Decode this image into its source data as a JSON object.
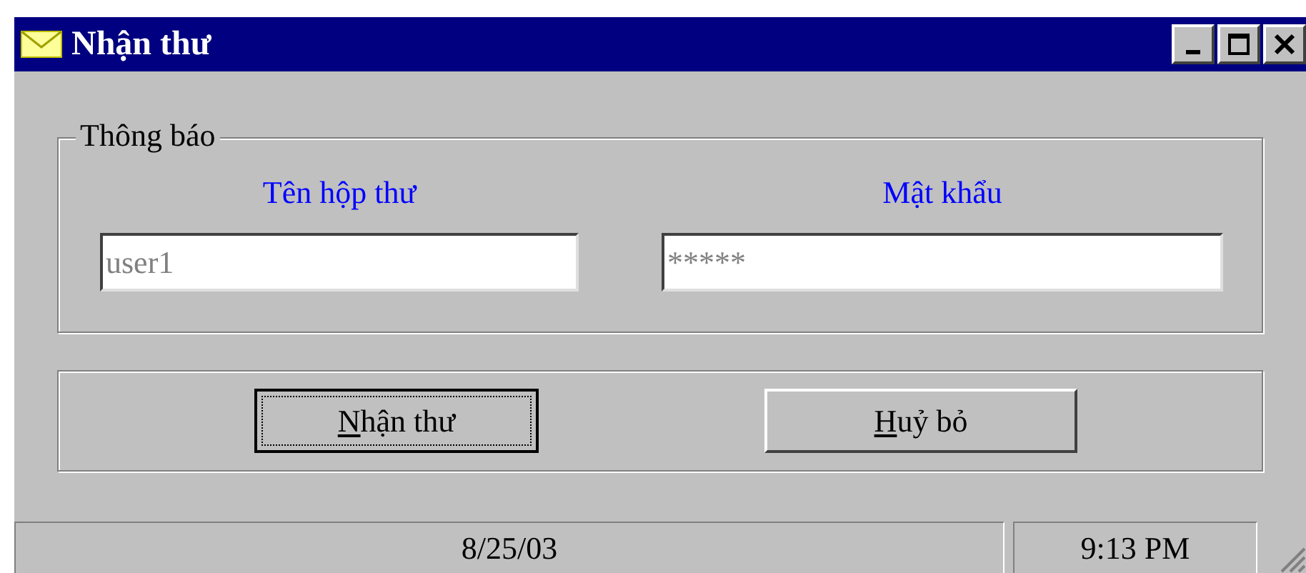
{
  "window": {
    "title": "Nhận thư"
  },
  "group": {
    "title": "Thông báo",
    "fields": [
      {
        "label": "Tên hộp thư",
        "value": "user1"
      },
      {
        "label": "Mật khẩu",
        "value": "*****"
      }
    ]
  },
  "buttons": [
    {
      "access_key": "N",
      "label_rest": "hận thư",
      "default": true
    },
    {
      "access_key": "H",
      "label_rest": "uỷ bỏ",
      "default": false
    }
  ],
  "status_bar": [
    "8/25/03",
    "9:13 PM"
  ]
}
